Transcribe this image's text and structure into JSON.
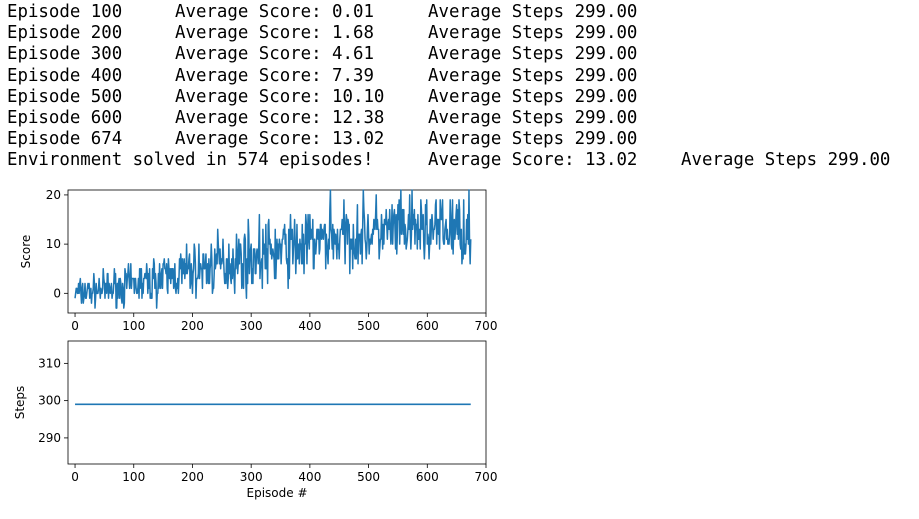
{
  "log": {
    "lines": [
      {
        "ep_label": "Episode 100",
        "score": "Average Score: 0.01",
        "steps": "Average Steps 299.00"
      },
      {
        "ep_label": "Episode 200",
        "score": "Average Score: 1.68",
        "steps": "Average Steps 299.00"
      },
      {
        "ep_label": "Episode 300",
        "score": "Average Score: 4.61",
        "steps": "Average Steps 299.00"
      },
      {
        "ep_label": "Episode 400",
        "score": "Average Score: 7.39",
        "steps": "Average Steps 299.00"
      },
      {
        "ep_label": "Episode 500",
        "score": "Average Score: 10.10",
        "steps": "Average Steps 299.00"
      },
      {
        "ep_label": "Episode 600",
        "score": "Average Score: 12.38",
        "steps": "Average Steps 299.00"
      },
      {
        "ep_label": "Episode 674",
        "score": "Average Score: 13.02",
        "steps": "Average Steps 299.00"
      }
    ],
    "solved": {
      "message": "Environment solved in 574 episodes!",
      "score": "Average Score: 13.02",
      "steps": "Average Steps 299.00"
    }
  },
  "chart_data": [
    {
      "type": "line",
      "xlabel": "",
      "ylabel": "Score",
      "xlim": [
        -12,
        700
      ],
      "ylim": [
        -4,
        21
      ],
      "xticks": [
        0,
        100,
        200,
        300,
        400,
        500,
        600,
        700
      ],
      "yticks": [
        0,
        10,
        20
      ],
      "color": "#1f77b4",
      "series_trend": {
        "x": [
          0,
          100,
          200,
          300,
          400,
          500,
          600,
          674
        ],
        "y": [
          0.01,
          1.68,
          4.61,
          7.39,
          10.1,
          12.38,
          13.02,
          13.02
        ]
      },
      "noise_amplitude": 4.5,
      "y_range_observed": [
        -3.5,
        21
      ]
    },
    {
      "type": "line",
      "xlabel": "Episode #",
      "ylabel": "Steps",
      "xlim": [
        -12,
        700
      ],
      "ylim": [
        283,
        316
      ],
      "xticks": [
        0,
        100,
        200,
        300,
        400,
        500,
        600,
        700
      ],
      "yticks": [
        290,
        300,
        310
      ],
      "color": "#1f77b4",
      "series": [
        {
          "x": [
            0,
            674
          ],
          "y": [
            299,
            299
          ]
        }
      ]
    }
  ]
}
